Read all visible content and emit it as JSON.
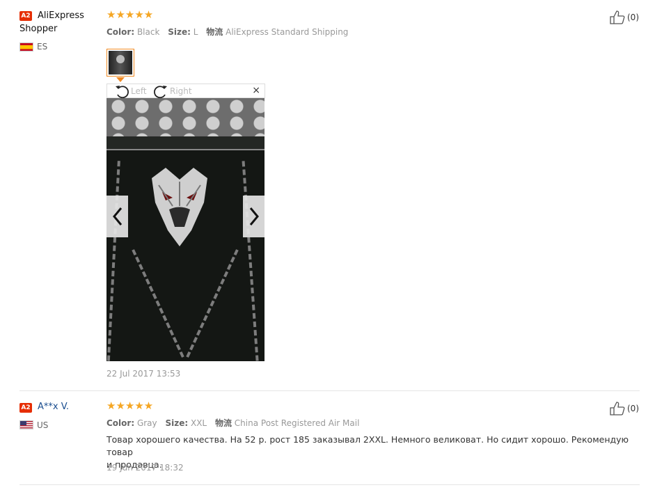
{
  "reviews": [
    {
      "badge": "A2",
      "name_line1": "AliExpress",
      "name_line2": "Shopper",
      "country": "ES",
      "stars": "★★★★★",
      "color_label": "Color:",
      "color_value": "Black",
      "size_label": "Size:",
      "size_value": "L",
      "shipping_label": "物流",
      "shipping_value": "AliExpress Standard Shipping",
      "helpful": "(0)",
      "date": "22 Jul 2017 13:53",
      "viewer": {
        "rotate_left": "Left",
        "rotate_right": "Right",
        "close": "×",
        "prev": "‹",
        "next": "›"
      }
    },
    {
      "badge": "A2",
      "name": "A**x V.",
      "country": "US",
      "stars": "★★★★★",
      "color_label": "Color:",
      "color_value": "Gray",
      "size_label": "Size:",
      "size_value": "XXL",
      "shipping_label": "物流",
      "shipping_value": "China Post Registered Air Mail",
      "text_line1": "Товар хорошего качества. На 52 р. рост 185 заказывал 2XXL. Немного великоват. Но сидит хорошо. Рекомендую товар",
      "text_line2": "и продавца.",
      "helpful": "(0)",
      "date": "19 Jun 2017 18:32"
    }
  ],
  "colors": {
    "accent": "#f08a24",
    "star": "#f5a623",
    "badge": "#e62e04",
    "link": "#1a4d8f"
  }
}
